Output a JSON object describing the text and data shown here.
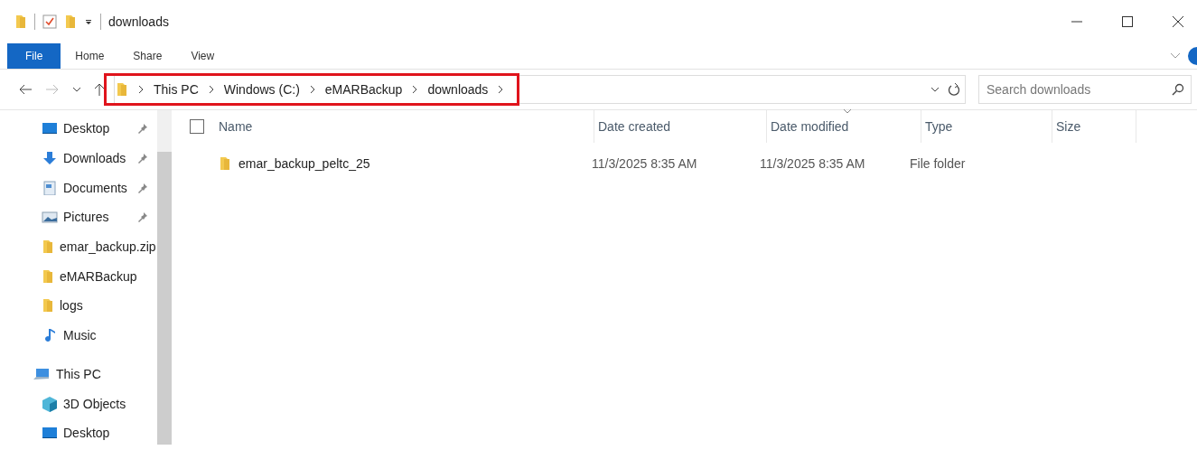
{
  "window": {
    "title": "downloads"
  },
  "ribbon_tabs": [
    {
      "label": "File",
      "selected": true
    },
    {
      "label": "Home",
      "selected": false
    },
    {
      "label": "Share",
      "selected": false
    },
    {
      "label": "View",
      "selected": false
    }
  ],
  "address": {
    "crumbs": [
      "This PC",
      "Windows (C:)",
      "eMARBackup",
      "downloads"
    ],
    "highlighted": true
  },
  "search": {
    "placeholder": "Search downloads"
  },
  "sidebar": {
    "items": [
      {
        "label": "Desktop",
        "kind": "desktop",
        "pinned": true
      },
      {
        "label": "Downloads",
        "kind": "downloads",
        "pinned": true
      },
      {
        "label": "Documents",
        "kind": "documents",
        "pinned": true
      },
      {
        "label": "Pictures",
        "kind": "pictures",
        "pinned": true
      },
      {
        "label": "emar_backup.zip",
        "kind": "folder",
        "pinned": false
      },
      {
        "label": "eMARBackup",
        "kind": "folder",
        "pinned": false
      },
      {
        "label": "logs",
        "kind": "folder",
        "pinned": false
      },
      {
        "label": "Music",
        "kind": "music",
        "pinned": false
      },
      {
        "label": "This PC",
        "kind": "pc",
        "pinned": false
      },
      {
        "label": "3D Objects",
        "kind": "objects",
        "pinned": false
      },
      {
        "label": "Desktop",
        "kind": "desktop",
        "pinned": false
      }
    ]
  },
  "table": {
    "columns": [
      {
        "label": "Name",
        "sorted": false
      },
      {
        "label": "Date created",
        "sorted": false
      },
      {
        "label": "Date modified",
        "sorted": true
      },
      {
        "label": "Type",
        "sorted": false
      },
      {
        "label": "Size",
        "sorted": false
      }
    ],
    "select_all": {
      "checked": false
    },
    "rows": [
      {
        "cells": [
          "emar_backup_peltc_25",
          "11/3/2025 8:35 AM",
          "11/3/2025 8:35 AM",
          "File folder"
        ]
      }
    ]
  }
}
